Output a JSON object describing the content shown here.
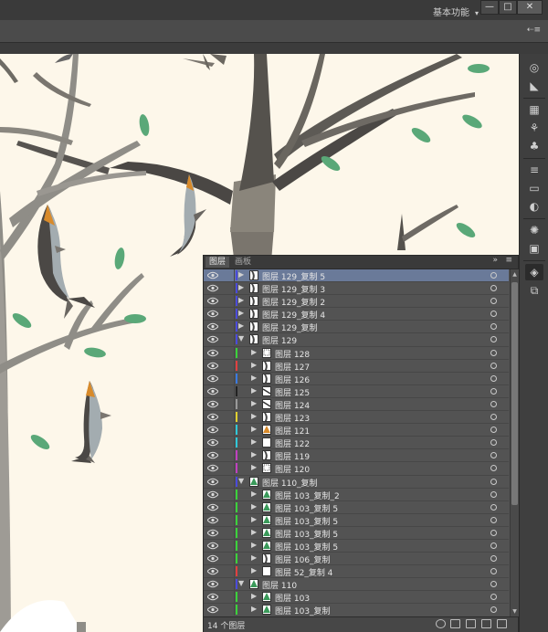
{
  "window": {
    "workspace_label": "基本功能",
    "workspace_caret": "▾",
    "minimize_symbol": "—",
    "maximize_symbol": "□",
    "close_symbol": "✕"
  },
  "controlbar": {
    "options_glyph": "⇠≡"
  },
  "panel": {
    "tabs": [
      "图层",
      "画板"
    ],
    "collapse_glyph": "»",
    "menu_glyph": "≡",
    "footer_count": "14 个图层",
    "layers": [
      {
        "name": "图层 129_复制 5",
        "indent": 0,
        "expanded": false,
        "color": "#4a4adb",
        "selected": true,
        "thumb": "shape"
      },
      {
        "name": "图层 129_复制 3",
        "indent": 0,
        "expanded": false,
        "color": "#4a4adb",
        "thumb": "shape"
      },
      {
        "name": "图层 129_复制 2",
        "indent": 0,
        "expanded": false,
        "color": "#4a4adb",
        "thumb": "shape"
      },
      {
        "name": "图层 129_复制 4",
        "indent": 0,
        "expanded": false,
        "color": "#4a4adb",
        "thumb": "shape"
      },
      {
        "name": "图层 129_复制",
        "indent": 0,
        "expanded": false,
        "color": "#4a4adb",
        "thumb": "shape"
      },
      {
        "name": "图层 129",
        "indent": 0,
        "expanded": true,
        "color": "#4a4adb",
        "thumb": "shape"
      },
      {
        "name": "图层 128",
        "indent": 1,
        "expanded": false,
        "color": "#3bd23b",
        "thumb": "dots"
      },
      {
        "name": "图层 127",
        "indent": 1,
        "expanded": false,
        "color": "#e04040",
        "thumb": "shape"
      },
      {
        "name": "图层 126",
        "indent": 1,
        "expanded": false,
        "color": "#3a7ae0",
        "thumb": "shape"
      },
      {
        "name": "图层 125",
        "indent": 1,
        "expanded": false,
        "color": "#222222",
        "thumb": "line"
      },
      {
        "name": "图层 124",
        "indent": 1,
        "expanded": false,
        "color": "#9a9a9a",
        "thumb": "line"
      },
      {
        "name": "图层 123",
        "indent": 1,
        "expanded": false,
        "color": "#e0d030",
        "thumb": "shape"
      },
      {
        "name": "图层 121",
        "indent": 1,
        "expanded": false,
        "color": "#30c8d8",
        "thumb": "orange"
      },
      {
        "name": "图层 122",
        "indent": 1,
        "expanded": false,
        "color": "#30c8d8",
        "thumb": "blank"
      },
      {
        "name": "图层 119",
        "indent": 1,
        "expanded": false,
        "color": "#c040c0",
        "thumb": "shape"
      },
      {
        "name": "图层 120",
        "indent": 1,
        "expanded": false,
        "color": "#c040c0",
        "thumb": "dots"
      },
      {
        "name": "图层 110_复制",
        "indent": 0,
        "expanded": true,
        "color": "#4a4adb",
        "thumb": "tree"
      },
      {
        "name": "图层 103_复制_2",
        "indent": 1,
        "expanded": false,
        "color": "#3bd23b",
        "thumb": "tree"
      },
      {
        "name": "图层 103_复制 5",
        "indent": 1,
        "expanded": false,
        "color": "#3bd23b",
        "thumb": "tree"
      },
      {
        "name": "图层 103_复制 5",
        "indent": 1,
        "expanded": false,
        "color": "#3bd23b",
        "thumb": "tree"
      },
      {
        "name": "图层 103_复制 5",
        "indent": 1,
        "expanded": false,
        "color": "#3bd23b",
        "thumb": "tree"
      },
      {
        "name": "图层 103_复制 5",
        "indent": 1,
        "expanded": false,
        "color": "#3bd23b",
        "thumb": "tree"
      },
      {
        "name": "图层 106_复制",
        "indent": 1,
        "expanded": false,
        "color": "#3bd23b",
        "thumb": "shape"
      },
      {
        "name": "图层 52_复制 4",
        "indent": 1,
        "expanded": false,
        "color": "#e04040",
        "thumb": "blank"
      },
      {
        "name": "图层 110",
        "indent": 0,
        "expanded": true,
        "color": "#4a4adb",
        "thumb": "tree"
      },
      {
        "name": "图层 103",
        "indent": 1,
        "expanded": false,
        "color": "#3bd23b",
        "thumb": "tree"
      },
      {
        "name": "图层 103_复制",
        "indent": 1,
        "expanded": false,
        "color": "#3bd23b",
        "thumb": "tree"
      }
    ]
  },
  "tools": [
    {
      "icon": "appearance-icon",
      "glyph": "◎"
    },
    {
      "icon": "gradient-wedge-icon",
      "glyph": "◣"
    },
    {
      "icon": "symbols-icon",
      "glyph": "▦"
    },
    {
      "icon": "brushes-icon",
      "glyph": "⚘"
    },
    {
      "icon": "club-icon",
      "glyph": "♣"
    },
    {
      "icon": "stroke-icon",
      "glyph": "≡"
    },
    {
      "icon": "gradient-icon",
      "glyph": "▭"
    },
    {
      "icon": "transparency-icon",
      "glyph": "◐"
    },
    {
      "icon": "color-guide-icon",
      "glyph": "✺"
    },
    {
      "icon": "image-trace-icon",
      "glyph": "▣"
    },
    {
      "icon": "layers-icon",
      "glyph": "◈"
    },
    {
      "icon": "artboards-icon",
      "glyph": "⧉"
    }
  ]
}
